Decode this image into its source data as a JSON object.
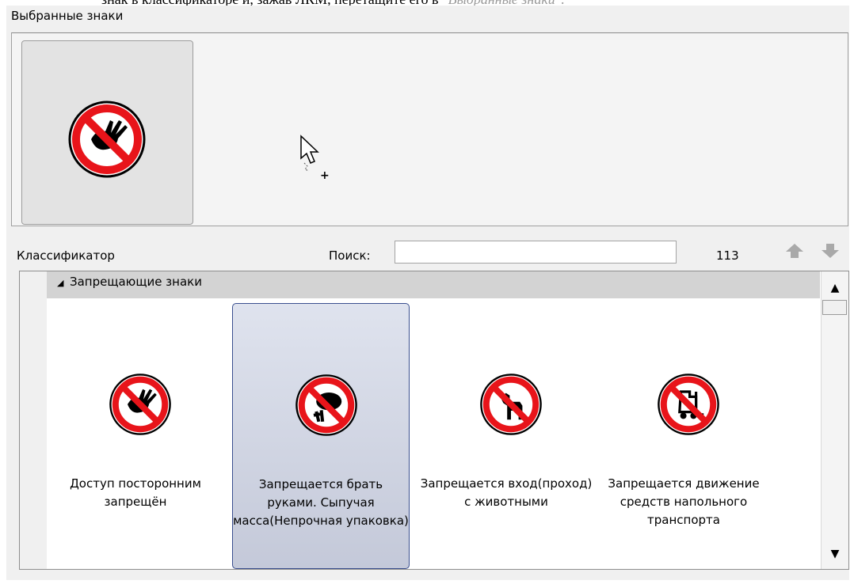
{
  "top_clipped": {
    "text": "знак в классификаторе и, зажав ЛКМ, перетащите его в",
    "emphasis": "\"Выбранные знаки\"."
  },
  "selected": {
    "label": "Выбранные знаки",
    "tiles": [
      {
        "icon": "no-entry-hand-sign-icon"
      }
    ]
  },
  "classifier": {
    "label": "Классификатор",
    "search_label": "Поиск:",
    "search_value": "",
    "count": "113"
  },
  "group": {
    "title": "Запрещающие знаки"
  },
  "items": [
    {
      "label": "Доступ посторонним запрещён",
      "icon": "no-entry-hand-sign-icon",
      "selected": false
    },
    {
      "label": "Запрещается брать руками. Сыпучая масса(Непрочная упаковка)",
      "icon": "no-touch-bulk-sign-icon",
      "selected": true
    },
    {
      "label": "Запрещается вход(проход) с животными",
      "icon": "no-animals-sign-icon",
      "selected": false
    },
    {
      "label": "Запрещается движение средств напольного транспорта",
      "icon": "no-forklift-sign-icon",
      "selected": false
    }
  ],
  "colors": {
    "sign_red": "#e8141a",
    "selection_border": "#3a4f8f"
  }
}
